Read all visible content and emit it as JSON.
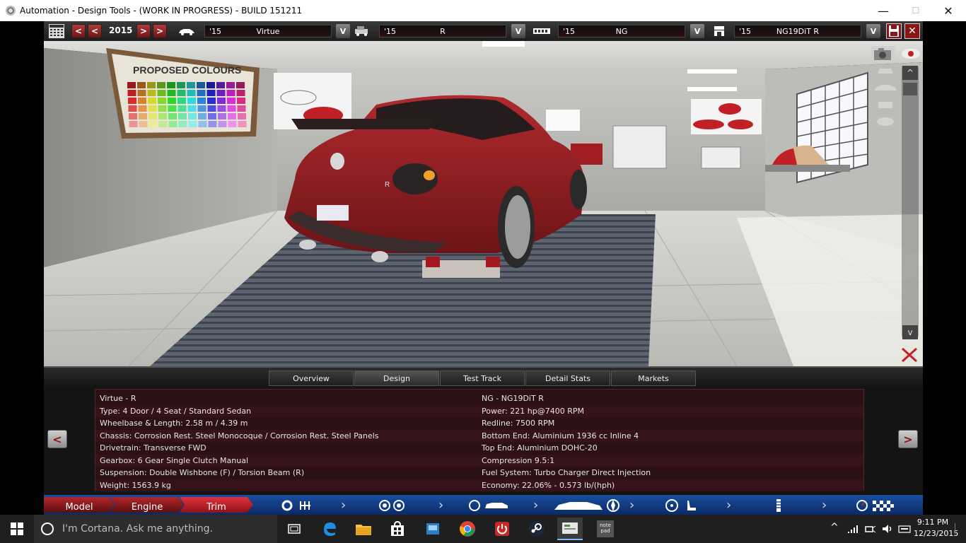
{
  "window": {
    "title": "Automation - Design Tools - (WORK IN PROGRESS) - BUILD 151211",
    "minimize": "—",
    "maximize": "☐",
    "close": "✕"
  },
  "toolbar": {
    "year": "2015",
    "prev_label": "<",
    "next_label": ">",
    "dropdown_label": "V",
    "model": {
      "year": "'15",
      "name": "Virtue"
    },
    "trim": {
      "year": "'15",
      "name": "R"
    },
    "engine_family": {
      "year": "'15",
      "name": "NG"
    },
    "engine_variant": {
      "year": "'15",
      "name": "NG19DiT R"
    }
  },
  "scene": {
    "poster_title": "PROPOSED COLOURS",
    "badge_letter": "R",
    "scroll_up": "^",
    "scroll_down": "v"
  },
  "tabs": [
    "Overview",
    "Design",
    "Test Track",
    "Detail Stats",
    "Markets"
  ],
  "active_tab": "Design",
  "info": {
    "left": [
      "Virtue - R",
      "Type: 4 Door / 4 Seat / Standard Sedan",
      "Wheelbase & Length: 2.58 m / 4.39 m",
      "Chassis: Corrosion Rest. Steel Monocoque / Corrosion Rest. Steel Panels",
      "Drivetrain: Transverse FWD",
      "Gearbox: 6 Gear Single Clutch Manual",
      "Suspension: Double Wishbone (F) / Torsion Beam (R)",
      "Weight: 1563.9 kg"
    ],
    "right": [
      "NG - NG19DiT R",
      "Power: 221 hp@7400 RPM",
      "Redline: 7500 RPM",
      "Bottom End: Aluminium 1936 cc Inline 4",
      "Top End: Aluminium DOHC-20",
      "Compression 9.5:1",
      "Fuel System: Turbo Charger Direct Injection",
      "Economy: 22.06% - 0.573 lb/(hph)"
    ],
    "prev_label": "<",
    "next_label": ">"
  },
  "bottom_nav": {
    "model": "Model",
    "engine": "Engine",
    "trim": "Trim"
  },
  "taskbar": {
    "search_placeholder": "I'm Cortana. Ask me anything.",
    "time": "9:11 PM",
    "date": "12/23/2015",
    "notepad_label": "note\npad"
  },
  "colors": {
    "accent_red": "#8a1515",
    "nav_blue": "#0a2a66",
    "panel_bg": "#2b1114"
  }
}
